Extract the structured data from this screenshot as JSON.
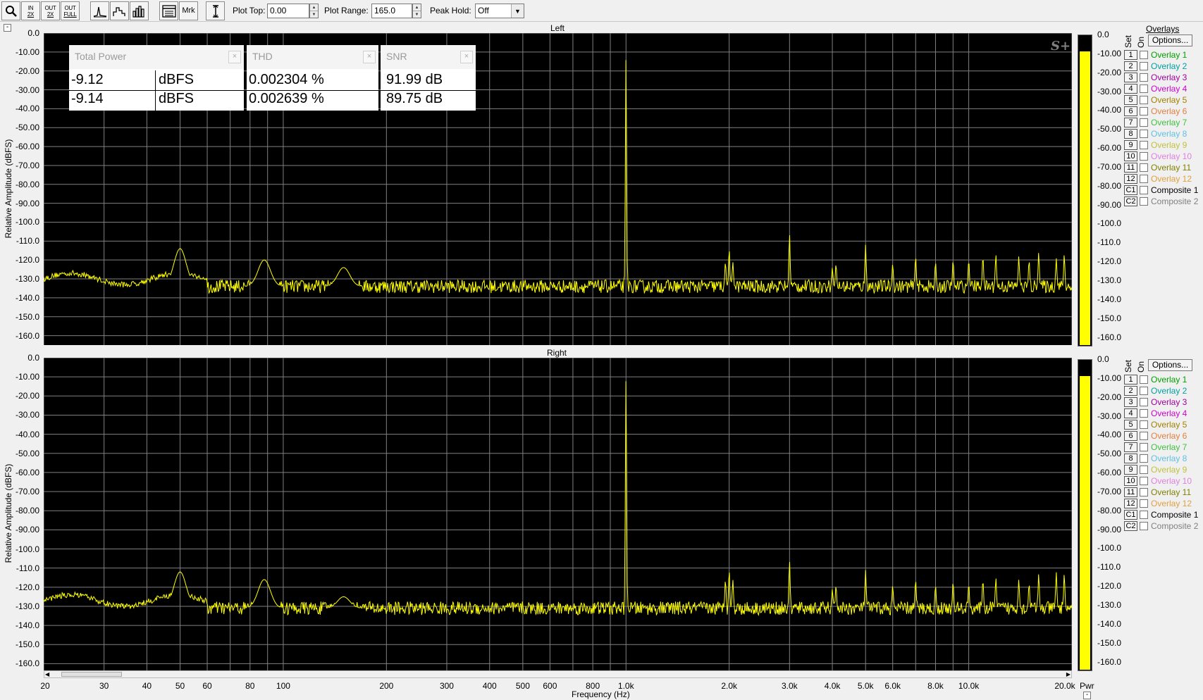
{
  "toolbar": {
    "buttons": [
      {
        "name": "zoom-button",
        "icon": "magnifier-icon"
      },
      {
        "name": "in-2x-button",
        "top": "IN",
        "bottom": "2X"
      },
      {
        "name": "out-2x-button",
        "top": "OUT",
        "bottom": "2X"
      },
      {
        "name": "out-full-button",
        "top": "OUT",
        "bottom": "FULL"
      },
      {
        "name": "view-line-button",
        "icon": "line-spectrum-icon"
      },
      {
        "name": "view-step-button",
        "icon": "step-spectrum-icon"
      },
      {
        "name": "view-bars-button",
        "icon": "bar-spectrum-icon"
      },
      {
        "name": "window-button",
        "icon": "window-icon"
      },
      {
        "name": "markers-button",
        "label": "Mrk"
      },
      {
        "name": "cursor-button",
        "icon": "vertical-cursor-icon"
      }
    ],
    "plot_top_label": "Plot Top:",
    "plot_top_value": "0.00",
    "plot_range_label": "Plot Range:",
    "plot_range_value": "165.0",
    "peak_hold_label": "Peak Hold:",
    "peak_hold_value": "Off"
  },
  "colors": {
    "trace": "#ffff00",
    "plot_bg": "#000000",
    "grid": "#808080"
  },
  "left_panel": {
    "title": "Left",
    "ylabel": "Relative Amplitude (dBFS)",
    "yticks": [
      "0.0",
      "-10.00",
      "-20.00",
      "-30.00",
      "-40.00",
      "-50.00",
      "-60.00",
      "-70.00",
      "-80.00",
      "-90.00",
      "-100.0",
      "-110.0",
      "-120.0",
      "-130.0",
      "-140.0",
      "-150.0",
      "-160.0"
    ],
    "badge": "S+"
  },
  "right_panel": {
    "title": "Right",
    "ylabel": "Relative Amplitude (dBFS)",
    "yticks": [
      "0.0",
      "-10.00",
      "-20.00",
      "-30.00",
      "-40.00",
      "-50.00",
      "-60.00",
      "-70.00",
      "-80.00",
      "-90.00",
      "-100.0",
      "-110.0",
      "-120.0",
      "-130.0",
      "-140.0",
      "-150.0",
      "-160.0"
    ]
  },
  "meter_ticks": [
    "0.0",
    "-10.00",
    "-20.00",
    "-30.00",
    "-40.00",
    "-50.00",
    "-60.00",
    "-70.00",
    "-80.00",
    "-90.00",
    "-100.0",
    "-110.0",
    "-120.0",
    "-130.0",
    "-140.0",
    "-150.0",
    "-160.0"
  ],
  "meter": {
    "left_level_db": -9.12,
    "right_level_db": -9.14,
    "pwr_label": "Pwr"
  },
  "measurements": {
    "total_power": {
      "title": "Total Power",
      "rows": [
        {
          "value": "-9.12",
          "unit": "dBFS"
        },
        {
          "value": "-9.14",
          "unit": "dBFS"
        }
      ]
    },
    "thd": {
      "title": "THD",
      "rows": [
        "0.002304 %",
        "0.002639 %"
      ]
    },
    "snr": {
      "title": "SNR",
      "rows": [
        "91.99 dB",
        "89.75 dB"
      ]
    }
  },
  "overlays": {
    "title": "Overlays",
    "options_label": "Options...",
    "set_label": "Set",
    "on_label": "On",
    "items": [
      {
        "num": "1",
        "name": "Overlay 1",
        "color": "#00a000"
      },
      {
        "num": "2",
        "name": "Overlay 2",
        "color": "#00a0a0"
      },
      {
        "num": "3",
        "name": "Overlay 3",
        "color": "#a000a0"
      },
      {
        "num": "4",
        "name": "Overlay 4",
        "color": "#d000d0"
      },
      {
        "num": "5",
        "name": "Overlay 5",
        "color": "#a08000"
      },
      {
        "num": "6",
        "name": "Overlay 6",
        "color": "#e08040"
      },
      {
        "num": "7",
        "name": "Overlay 7",
        "color": "#40c040"
      },
      {
        "num": "8",
        "name": "Overlay 8",
        "color": "#60c0e0"
      },
      {
        "num": "9",
        "name": "Overlay 9",
        "color": "#c0c040"
      },
      {
        "num": "10",
        "name": "Overlay 10",
        "color": "#e080e0"
      },
      {
        "num": "11",
        "name": "Overlay 11",
        "color": "#808000"
      },
      {
        "num": "12",
        "name": "Overlay 12",
        "color": "#e0a040"
      },
      {
        "num": "C1",
        "name": "Composite 1",
        "color": "#000000"
      },
      {
        "num": "C2",
        "name": "Composite 2",
        "color": "#808080"
      }
    ]
  },
  "x_axis": {
    "label": "Frequency (Hz)",
    "ticks": [
      {
        "label": "20",
        "f": 20
      },
      {
        "label": "30",
        "f": 30
      },
      {
        "label": "40",
        "f": 40
      },
      {
        "label": "50",
        "f": 50
      },
      {
        "label": "60",
        "f": 60
      },
      {
        "label": "80",
        "f": 80
      },
      {
        "label": "100",
        "f": 100
      },
      {
        "label": "200",
        "f": 200
      },
      {
        "label": "300",
        "f": 300
      },
      {
        "label": "400",
        "f": 400
      },
      {
        "label": "500",
        "f": 500
      },
      {
        "label": "600",
        "f": 600
      },
      {
        "label": "800",
        "f": 800
      },
      {
        "label": "1.0k",
        "f": 1000
      },
      {
        "label": "2.0k",
        "f": 2000
      },
      {
        "label": "3.0k",
        "f": 3000
      },
      {
        "label": "4.0k",
        "f": 4000
      },
      {
        "label": "5.0k",
        "f": 5000
      },
      {
        "label": "6.0k",
        "f": 6000
      },
      {
        "label": "8.0k",
        "f": 8000
      },
      {
        "label": "10.0k",
        "f": 10000
      },
      {
        "label": "20.0k",
        "f": 20000
      }
    ]
  },
  "chart_data": [
    {
      "type": "line",
      "title": "Left",
      "xlabel": "Frequency (Hz)",
      "ylabel": "Relative Amplitude (dBFS)",
      "xscale": "log",
      "xlim": [
        20,
        20000
      ],
      "ylim": [
        -165,
        0
      ],
      "grid": true,
      "noise_floor_db": -134,
      "peaks": [
        {
          "f": 50,
          "db": -114
        },
        {
          "f": 88,
          "db": -120
        },
        {
          "f": 150,
          "db": -124
        },
        {
          "f": 1000,
          "db": -12
        },
        {
          "f": 1950,
          "db": -121
        },
        {
          "f": 2000,
          "db": -114
        },
        {
          "f": 2050,
          "db": -121
        },
        {
          "f": 3000,
          "db": -106
        },
        {
          "f": 4000,
          "db": -124
        },
        {
          "f": 4100,
          "db": -122
        },
        {
          "f": 5000,
          "db": -112
        },
        {
          "f": 6000,
          "db": -122
        },
        {
          "f": 7000,
          "db": -118
        },
        {
          "f": 8000,
          "db": -121
        },
        {
          "f": 9000,
          "db": -120
        },
        {
          "f": 10000,
          "db": -120
        },
        {
          "f": 11000,
          "db": -118
        },
        {
          "f": 12000,
          "db": -117
        },
        {
          "f": 14000,
          "db": -118
        },
        {
          "f": 15000,
          "db": -120
        },
        {
          "f": 16000,
          "db": -116
        },
        {
          "f": 18000,
          "db": -119
        },
        {
          "f": 19000,
          "db": -117
        }
      ]
    },
    {
      "type": "line",
      "title": "Right",
      "xlabel": "Frequency (Hz)",
      "ylabel": "Relative Amplitude (dBFS)",
      "xscale": "log",
      "xlim": [
        20,
        20000
      ],
      "ylim": [
        -165,
        0
      ],
      "grid": true,
      "noise_floor_db": -131,
      "peaks": [
        {
          "f": 50,
          "db": -112
        },
        {
          "f": 88,
          "db": -116
        },
        {
          "f": 150,
          "db": -125
        },
        {
          "f": 1000,
          "db": -10
        },
        {
          "f": 1950,
          "db": -116
        },
        {
          "f": 2000,
          "db": -111
        },
        {
          "f": 2050,
          "db": -116
        },
        {
          "f": 3000,
          "db": -106
        },
        {
          "f": 4000,
          "db": -121
        },
        {
          "f": 4100,
          "db": -119
        },
        {
          "f": 5000,
          "db": -111
        },
        {
          "f": 6000,
          "db": -119
        },
        {
          "f": 7000,
          "db": -116
        },
        {
          "f": 8000,
          "db": -119
        },
        {
          "f": 9000,
          "db": -117
        },
        {
          "f": 10000,
          "db": -118
        },
        {
          "f": 11000,
          "db": -116
        },
        {
          "f": 12000,
          "db": -115
        },
        {
          "f": 14000,
          "db": -116
        },
        {
          "f": 15000,
          "db": -118
        },
        {
          "f": 16000,
          "db": -113
        },
        {
          "f": 18000,
          "db": -112
        },
        {
          "f": 19000,
          "db": -113
        }
      ]
    }
  ]
}
